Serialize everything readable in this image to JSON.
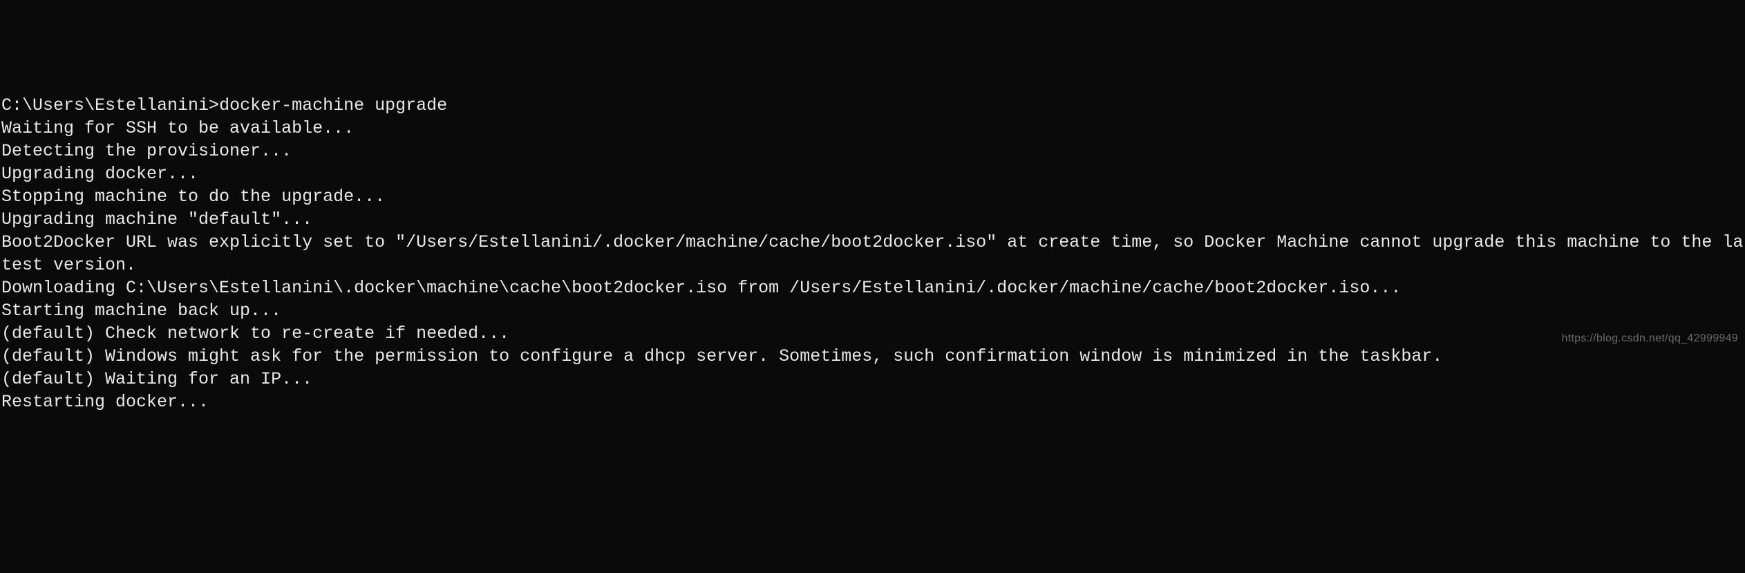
{
  "terminal": {
    "prompt": "C:\\Users\\Estellanini>",
    "command": "docker-machine upgrade",
    "lines": [
      "Waiting for SSH to be available...",
      "Detecting the provisioner...",
      "Upgrading docker...",
      "Stopping machine to do the upgrade...",
      "Upgrading machine \"default\"...",
      "Boot2Docker URL was explicitly set to \"/Users/Estellanini/.docker/machine/cache/boot2docker.iso\" at create time, so Docker Machine cannot upgrade this machine to the latest version.",
      "Downloading C:\\Users\\Estellanini\\.docker\\machine\\cache\\boot2docker.iso from /Users/Estellanini/.docker/machine/cache/boot2docker.iso...",
      "Starting machine back up...",
      "(default) Check network to re-create if needed...",
      "(default) Windows might ask for the permission to configure a dhcp server. Sometimes, such confirmation window is minimized in the taskbar.",
      "(default) Waiting for an IP...",
      "Restarting docker..."
    ]
  },
  "watermark": "https://blog.csdn.net/qq_42999949"
}
